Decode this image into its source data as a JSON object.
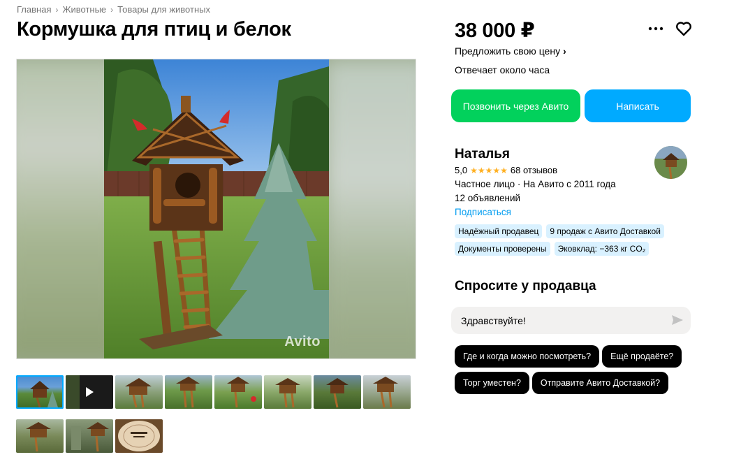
{
  "breadcrumb": [
    "Главная",
    "Животные",
    "Товары для животных"
  ],
  "title": "Кормушка для птиц и белок",
  "gallery": {
    "watermark": "Avito",
    "thumbnail_count": 11,
    "active_index": 0,
    "video_index": 1
  },
  "price": "38 000 ₽",
  "offer_price_label": "Предложить свою цену",
  "reply_time": "Отвечает около часа",
  "buttons": {
    "call": "Позвонить через Авито",
    "write": "Написать"
  },
  "seller": {
    "name": "Наталья",
    "rating": "5,0",
    "reviews": "68 отзывов",
    "type": "Частное лицо · На Авито с 2011 года",
    "listings": "12 объявлений",
    "subscribe": "Подписаться",
    "badges": [
      "Надёжный продавец",
      "9 продаж с Авито Доставкой",
      "Документы проверены",
      "Эковклад: −363 кг CO₂"
    ]
  },
  "ask": {
    "title": "Спросите у продавца",
    "message": "Здравствуйте!",
    "quick_questions": [
      "Где и когда можно посмотреть?",
      "Ещё продаёте?",
      "Торг уместен?",
      "Отправите Авито Доставкой?"
    ]
  },
  "colors": {
    "green": "#02d15c",
    "blue": "#00aaff",
    "badge": "#d9f1ff",
    "star": "#ffb021"
  }
}
